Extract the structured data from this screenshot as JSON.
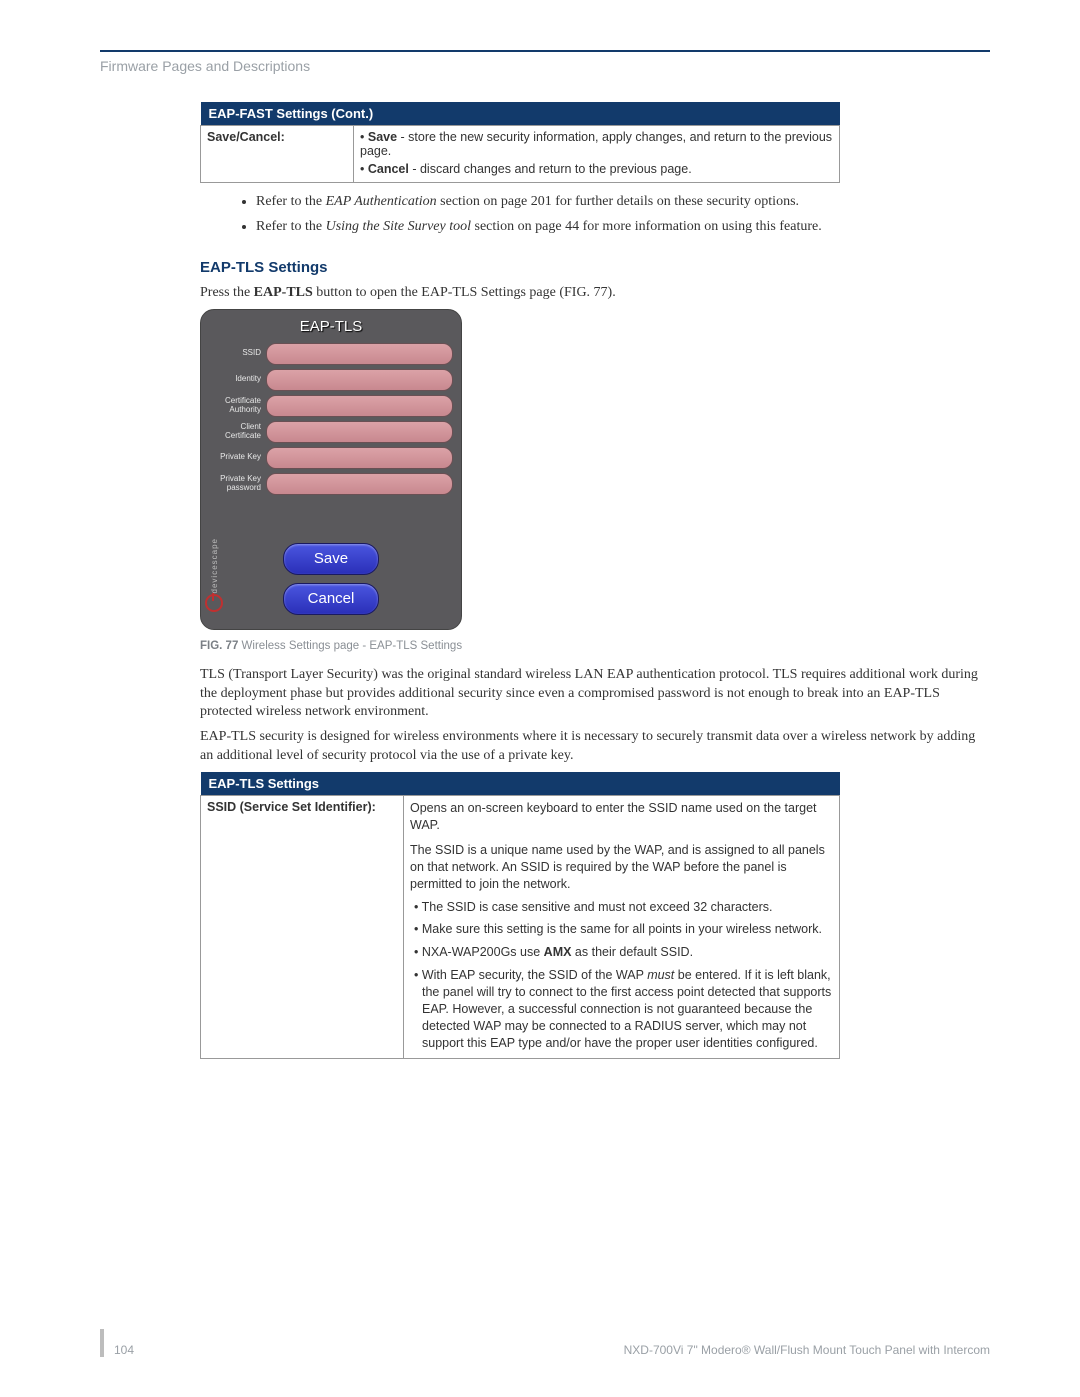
{
  "header": {
    "section_title": "Firmware Pages and Descriptions"
  },
  "table1": {
    "title": "EAP-FAST Settings (Cont.)",
    "row1_label": "Save/Cancel:",
    "row1_save_bold": "Save",
    "row1_save_text": " - store the new security information, apply changes, and return to the previous page.",
    "row1_cancel_bold": "Cancel",
    "row1_cancel_text": " - discard changes and return to the previous page."
  },
  "refs": {
    "b1_a": "Refer to the ",
    "b1_i": "EAP Authentication",
    "b1_b": " section on page 201 for further details on these security options.",
    "b2_a": "Refer to the ",
    "b2_i": "Using the Site Survey tool",
    "b2_b": " section on page 44 for more information on using this feature."
  },
  "section": {
    "heading": "EAP-TLS Settings",
    "intro_a": "Press the ",
    "intro_b": "EAP-TLS",
    "intro_c": " button to open the EAP-TLS Settings page (FIG. 77)."
  },
  "panel": {
    "title": "EAP-TLS",
    "labels": [
      "SSID",
      "Identity",
      "Certificate Authority",
      "Client Certificate",
      "Private Key",
      "Private Key password"
    ],
    "save": "Save",
    "cancel": "Cancel",
    "side": "devicescape"
  },
  "figcap": {
    "bold": "FIG. 77",
    "rest": "  Wireless Settings page - EAP-TLS Settings"
  },
  "para1": "TLS (Transport Layer Security) was the original standard wireless LAN EAP authentication protocol. TLS requires additional work during the deployment phase but provides additional security since even a compromised password is not enough to break into an EAP-TLS protected wireless network environment.",
  "para2": "EAP-TLS security is designed for wireless environments where it is necessary to securely transmit data over a wireless network by adding an additional level of security protocol via the use of a private key.",
  "table2": {
    "title": "EAP-TLS Settings",
    "row1_label": "SSID (Service Set Identifier):",
    "d1": "Opens an on-screen keyboard to enter the SSID name used on the target WAP.",
    "d2": "The SSID is a unique name used by the WAP, and is assigned to all panels on that network. An SSID is required by the WAP before the panel is permitted to join the network.",
    "d3": "The SSID is case sensitive and must not exceed 32 characters.",
    "d4": "Make sure this setting is the same for all points in your wireless network.",
    "d5a": "NXA-WAP200Gs use ",
    "d5b": "AMX",
    "d5c": " as their default SSID.",
    "d6a": "With EAP security, the SSID of the WAP ",
    "d6i": "must",
    "d6b": " be entered. If it is left blank, the panel will try to connect to the first access point detected that supports EAP. However, a successful connection is not guaranteed because the detected WAP may be connected to a RADIUS server, which may not support this EAP type and/or have the proper user identities configured."
  },
  "footer": {
    "page": "104",
    "title": "NXD-700Vi 7\" Modero® Wall/Flush Mount Touch Panel with Intercom"
  }
}
